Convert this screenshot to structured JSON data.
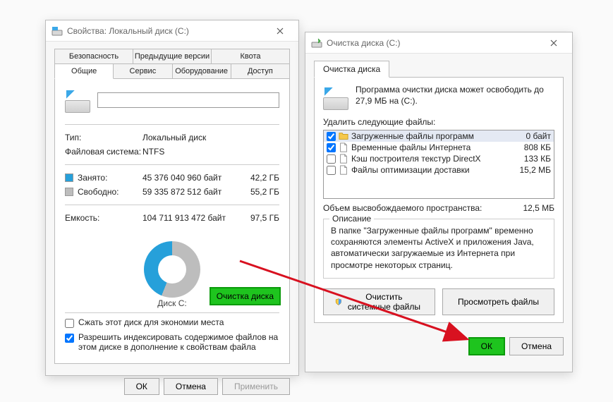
{
  "left": {
    "title": "Свойства: Локальный диск (C:)",
    "tabs_row1": [
      "Безопасность",
      "Предыдущие версии",
      "Квота"
    ],
    "tabs_row2": [
      "Общие",
      "Сервис",
      "Оборудование",
      "Доступ"
    ],
    "drive_name": "",
    "type_label": "Тип:",
    "type_value": "Локальный диск",
    "fs_label": "Файловая система:",
    "fs_value": "NTFS",
    "used_label": "Занято:",
    "used_bytes": "45 376 040 960 байт",
    "used_gb": "42,2 ГБ",
    "free_label": "Свободно:",
    "free_bytes": "59 335 872 512 байт",
    "free_gb": "55,2 ГБ",
    "cap_label": "Емкость:",
    "cap_bytes": "104 711 913 472 байт",
    "cap_gb": "97,5 ГБ",
    "drive_caption": "Диск C:",
    "cleanup_btn": "Очистка диска",
    "compress_label": "Сжать этот диск для экономии места",
    "index_label": "Разрешить индексировать содержимое файлов на этом диске в дополнение к свойствам файла",
    "ok": "ОК",
    "cancel": "Отмена",
    "apply": "Применить"
  },
  "right": {
    "title": "Очистка диска  (C:)",
    "tab": "Очистка диска",
    "head_msg": "Программа очистки диска может освободить до 27,9 МБ на  (C:).",
    "list_label": "Удалить следующие файлы:",
    "items": [
      {
        "checked": true,
        "icon": "folder",
        "label": "Загруженные файлы программ",
        "size": "0 байт",
        "selected": true
      },
      {
        "checked": true,
        "icon": "file",
        "label": "Временные файлы Интернета",
        "size": "808 КБ"
      },
      {
        "checked": false,
        "icon": "file",
        "label": "Кэш построителя текстур DirectX",
        "size": "133 КБ"
      },
      {
        "checked": false,
        "icon": "file",
        "label": "Файлы оптимизации доставки",
        "size": "15,2 МБ"
      }
    ],
    "total_label": "Объем высвобождаемого пространства:",
    "total_value": "12,5 МБ",
    "desc_legend": "Описание",
    "desc_text": "В папке \"Загруженные файлы программ\" временно сохраняются элементы ActiveX и приложения Java, автоматически загружаемые из Интернета при просмотре некоторых страниц.",
    "clean_sys": "Очистить системные файлы",
    "view_files": "Просмотреть файлы",
    "ok": "ОК",
    "cancel": "Отмена"
  },
  "colors": {
    "used": "#26a0da",
    "free": "#bdbdbd",
    "highlight": "#1ec41e",
    "highlight_border": "#0a9a0a",
    "arrow": "#d81120"
  }
}
